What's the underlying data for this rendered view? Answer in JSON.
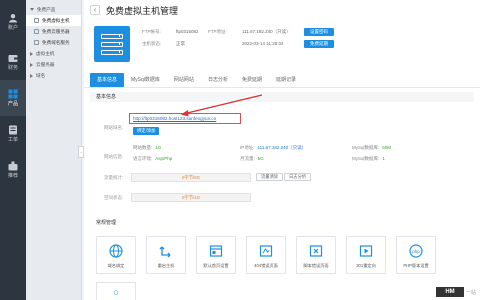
{
  "nav": [
    {
      "label": "账户",
      "icon": "user-icon"
    },
    {
      "label": "财务",
      "icon": "wallet-icon"
    },
    {
      "label": "产品",
      "icon": "grid-icon"
    },
    {
      "label": "工单",
      "icon": "ticket-icon"
    },
    {
      "label": "推荐",
      "icon": "share-icon"
    }
  ],
  "menu": {
    "group_open": "免费产品",
    "items": [
      "免费虚拟主机",
      "免费云服务器",
      "免费域名服务"
    ],
    "groups_closed": [
      "虚拟主机",
      "云服务器",
      "域名"
    ]
  },
  "header": {
    "back": "‹",
    "title": "免费虚拟主机管理"
  },
  "product": {
    "ftp_label": "FTP帐号:",
    "ftp_value": "ftp0315082",
    "ftp_addr_label": "FTP地址:",
    "ftp_addr_value": "111.67.182.240（只读）",
    "reset_btn": "设置密码",
    "status_label": "主机状态:",
    "status_value": "正常",
    "expire_value": "2022-03-14 11:25:02",
    "renew_btn": "免费延期"
  },
  "tabs": [
    "基本信息",
    "MySql数据库",
    "网站网站",
    "日志分析",
    "免费延期",
    "延期记录"
  ],
  "section_basic": "基本信息",
  "domain": {
    "label": "网站域名:",
    "url": "http://ftp0315082.host123.sanfengyun.cn",
    "bind_btn": "绑定/添加"
  },
  "stats": {
    "label": "网站信息:",
    "site_count_label": "网站数量:",
    "site_count": "1G",
    "ip_label": "IP地址:",
    "ip": "111.67.182.240（只读）",
    "mysql_label": "MySql数据库:",
    "mysql": "50M",
    "env_label": "语言环境:",
    "env": "Asp/Php",
    "bw_label": "月流量:",
    "bw": "5G",
    "mysql_count_label": "MySql数据库:",
    "mysql_count": "1"
  },
  "traffic": {
    "label": "流量统计:",
    "usage": "0字节/5G",
    "btn1": "流量清除",
    "btn2": "日志分析"
  },
  "space": {
    "label": "空间状态:",
    "usage": "0字节/1G"
  },
  "tools_title": "常规管理",
  "tools": [
    {
      "label": "域名绑定",
      "icon": "globe-icon"
    },
    {
      "label": "重启主机",
      "icon": "restart-icon"
    },
    {
      "label": "默认首页设置",
      "icon": "homepage-icon"
    },
    {
      "label": "404错误页面",
      "icon": "404-icon"
    },
    {
      "label": "脚本错误页面",
      "icon": "script-error-icon"
    },
    {
      "label": "301重定向",
      "icon": "redirect-icon"
    },
    {
      "label": "PHP版本设置",
      "icon": "php-icon"
    }
  ],
  "colors": {
    "accent": "#1d8fe3",
    "nav_bg": "#2d3540",
    "annotation": "#e03030"
  },
  "watermark": {
    "logo": "HM",
    "text": "一站"
  }
}
